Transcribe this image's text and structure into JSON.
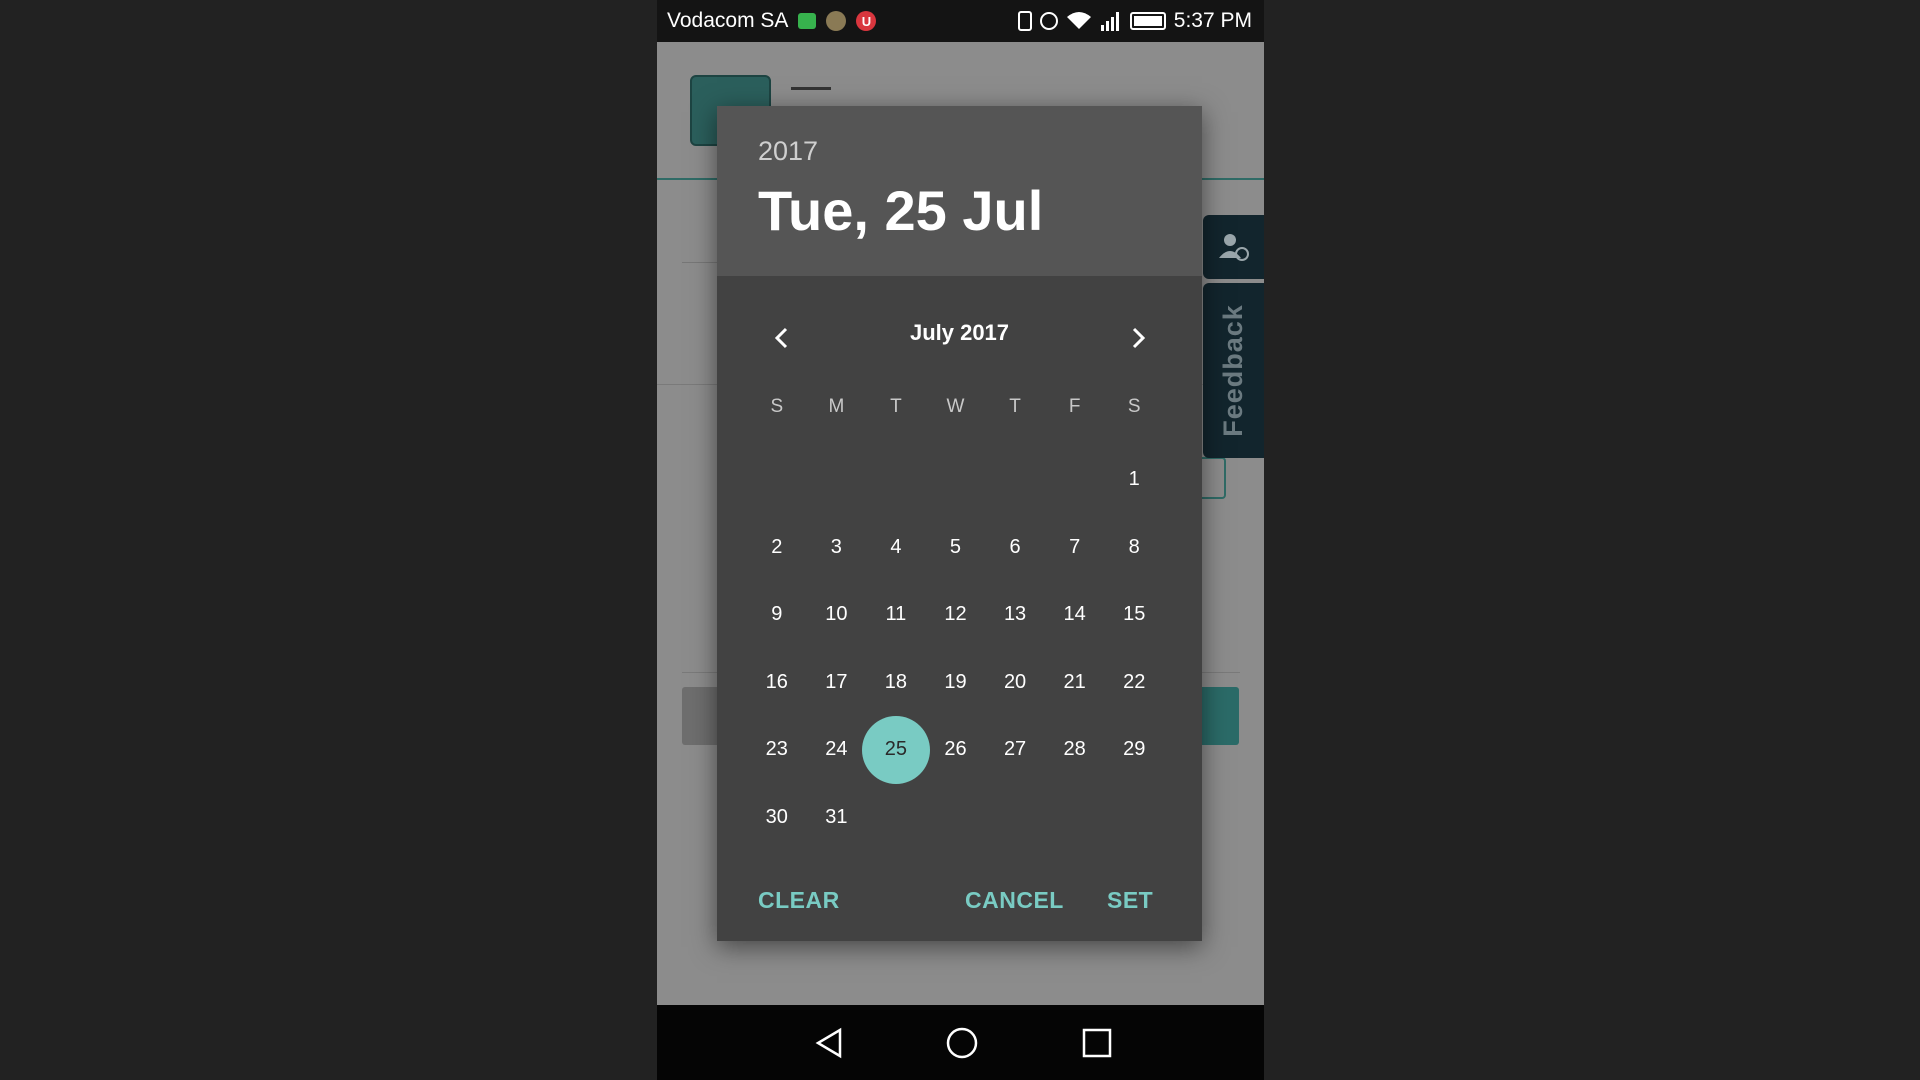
{
  "status_bar": {
    "carrier": "Vodacom SA",
    "u_badge": "U",
    "time": "5:37 PM",
    "icons": [
      "chat-icon",
      "grenade-icon",
      "u-badge-icon",
      "vibrate-icon",
      "alarm-icon",
      "wifi-icon",
      "signal-icon",
      "battery-icon"
    ]
  },
  "side_panel": {
    "feedback_label": "Feedback",
    "user_icon": "user-sync-icon"
  },
  "date_picker": {
    "year": "2017",
    "selected_date": "Tue, 25 Jul",
    "month_label": "July 2017",
    "prev_icon": "chevron-left-icon",
    "next_icon": "chevron-right-icon",
    "weekdays": [
      "S",
      "M",
      "T",
      "W",
      "T",
      "F",
      "S"
    ],
    "days": [
      "",
      "",
      "",
      "",
      "",
      "",
      "1",
      "2",
      "3",
      "4",
      "5",
      "6",
      "7",
      "8",
      "9",
      "10",
      "11",
      "12",
      "13",
      "14",
      "15",
      "16",
      "17",
      "18",
      "19",
      "20",
      "21",
      "22",
      "23",
      "24",
      "25",
      "26",
      "27",
      "28",
      "29",
      "30",
      "31"
    ],
    "selected_day": "25",
    "accent_color": "#79cbc3",
    "actions": {
      "clear": "CLEAR",
      "cancel": "CANCEL",
      "set": "SET"
    }
  },
  "nav_bar": {
    "icons": [
      "back-triangle-icon",
      "home-circle-icon",
      "recents-square-icon"
    ]
  }
}
